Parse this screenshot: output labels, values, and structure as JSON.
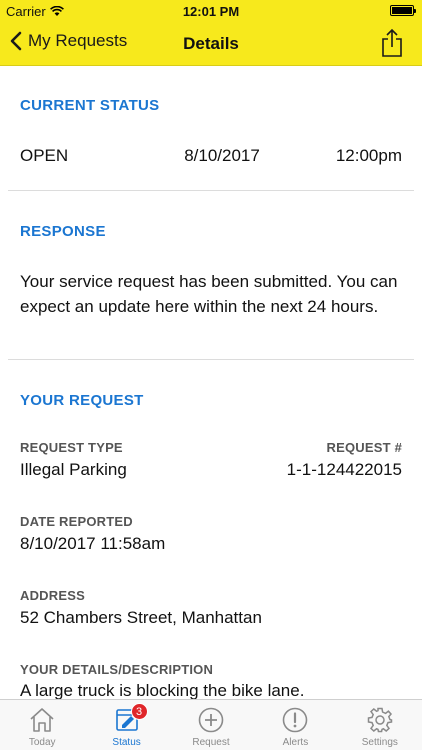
{
  "status_bar": {
    "carrier": "Carrier",
    "time": "12:01 PM"
  },
  "nav": {
    "back_label": "My Requests",
    "title": "Details"
  },
  "current_status": {
    "heading": "CURRENT STATUS",
    "state": "OPEN",
    "date": "8/10/2017",
    "time": "12:00pm"
  },
  "response": {
    "heading": "RESPONSE",
    "text": "Your service request has been submitted. You can expect an update here within the next 24 hours."
  },
  "your_request": {
    "heading": "YOUR REQUEST",
    "type_label": "REQUEST TYPE",
    "type_value": "Illegal Parking",
    "number_label": "REQUEST #",
    "number_value": "1-1-124422015",
    "date_label": "DATE REPORTED",
    "date_value": "8/10/2017 11:58am",
    "address_label": "ADDRESS",
    "address_value": "52 Chambers Street, Manhattan",
    "details_label": "YOUR DETAILS/DESCRIPTION",
    "details_value": "A large truck is blocking the bike lane."
  },
  "tabs": [
    {
      "label": "Today",
      "icon": "home-icon"
    },
    {
      "label": "Status",
      "icon": "status-icon",
      "badge": "3"
    },
    {
      "label": "Request",
      "icon": "plus-circle-icon"
    },
    {
      "label": "Alerts",
      "icon": "alert-icon"
    },
    {
      "label": "Settings",
      "icon": "gear-icon"
    }
  ],
  "colors": {
    "brand_yellow": "#f7e91c",
    "accent_blue": "#1b76d1",
    "badge_red": "#e0262a"
  }
}
